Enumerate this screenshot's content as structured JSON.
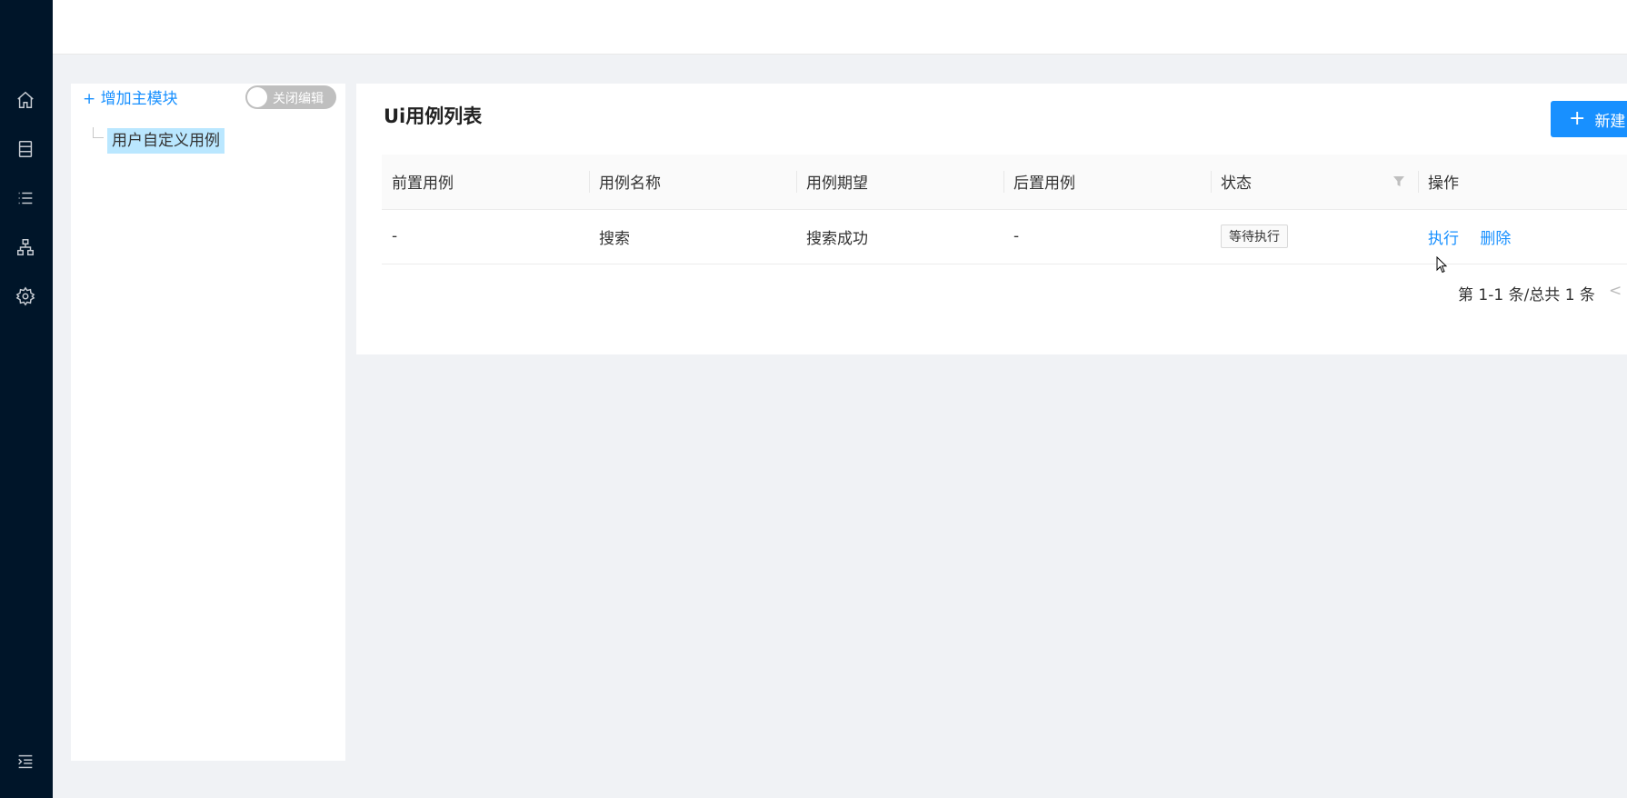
{
  "sidebar": {
    "icons": [
      "home-icon",
      "server-icon",
      "list-icon",
      "sitemap-icon",
      "gear-icon",
      "menu-collapse-icon"
    ]
  },
  "tree": {
    "add_module": "+ 增加主模块",
    "toggle_label": "关闭编辑",
    "node_label": "用户自定义用例"
  },
  "main": {
    "title": "Ui用例列表",
    "new_button": "新建",
    "columns": [
      "前置用例",
      "用例名称",
      "用例期望",
      "后置用例",
      "状态",
      "操作"
    ],
    "rows": [
      {
        "pre_case": "-",
        "name": "搜索",
        "expectation": "搜索成功",
        "post_case": "-",
        "status": "等待执行",
        "actions": [
          "执行",
          "删除"
        ]
      }
    ],
    "pagination_text": "第 1-1 条/总共 1 条",
    "prev_symbol": "<"
  },
  "colors": {
    "sidebar_bg": "#001529",
    "primary": "#1890ff",
    "page_bg": "#f0f2f5",
    "selected_node": "#bae7ff"
  }
}
